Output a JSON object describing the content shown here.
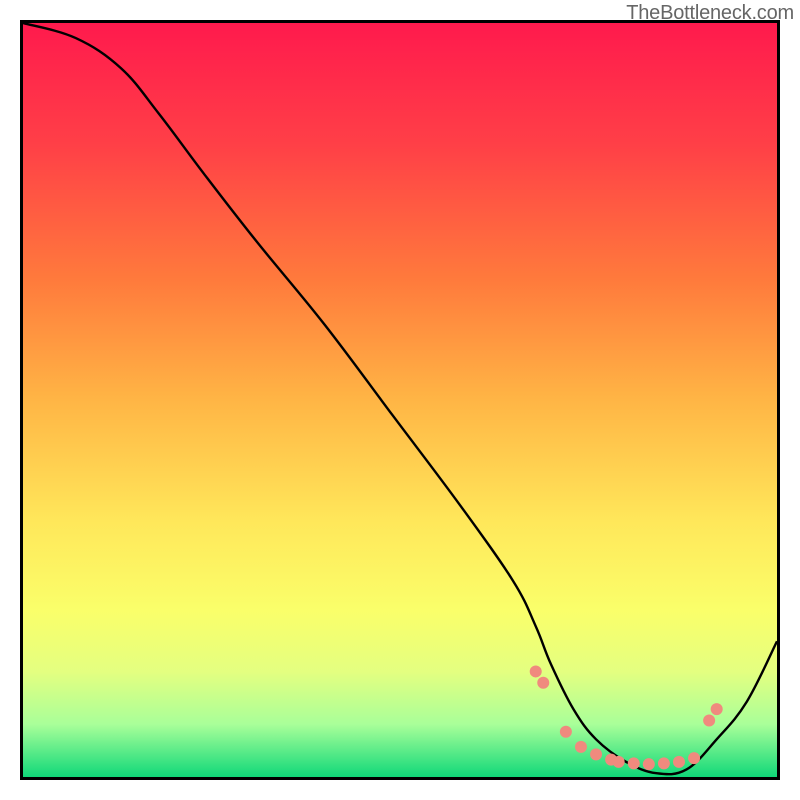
{
  "watermark": "TheBottleneck.com",
  "chart_data": {
    "type": "line",
    "title": "",
    "xlabel": "",
    "ylabel": "",
    "xlim": [
      0,
      100
    ],
    "ylim": [
      0,
      100
    ],
    "background_gradient": {
      "type": "vertical",
      "stops": [
        {
          "pos": 0.0,
          "color": "#ff1a4d"
        },
        {
          "pos": 0.16,
          "color": "#ff3f47"
        },
        {
          "pos": 0.34,
          "color": "#ff7a3c"
        },
        {
          "pos": 0.5,
          "color": "#ffb545"
        },
        {
          "pos": 0.66,
          "color": "#ffe75a"
        },
        {
          "pos": 0.78,
          "color": "#faff6a"
        },
        {
          "pos": 0.86,
          "color": "#e4ff80"
        },
        {
          "pos": 0.93,
          "color": "#a9ff99"
        },
        {
          "pos": 1.0,
          "color": "#10d879"
        }
      ]
    },
    "series": [
      {
        "name": "bottleneck-curve",
        "color": "#000000",
        "stroke_width": 2.4,
        "x": [
          0,
          7,
          13,
          18,
          24,
          31,
          40,
          49,
          58,
          65,
          68,
          70,
          73,
          76,
          80,
          84,
          88,
          92,
          96,
          100
        ],
        "y": [
          100,
          98,
          94,
          88,
          80,
          71,
          60,
          48,
          36,
          26,
          20,
          15,
          9,
          5,
          2,
          0.5,
          1,
          5,
          10,
          18
        ]
      }
    ],
    "markers": {
      "name": "dot-region",
      "shape": "circle",
      "color": "#f08a7e",
      "radius_px": 6,
      "points": [
        {
          "x": 68,
          "y": 14
        },
        {
          "x": 69,
          "y": 12.5
        },
        {
          "x": 72,
          "y": 6
        },
        {
          "x": 74,
          "y": 4
        },
        {
          "x": 76,
          "y": 3
        },
        {
          "x": 78,
          "y": 2.3
        },
        {
          "x": 79,
          "y": 2
        },
        {
          "x": 81,
          "y": 1.8
        },
        {
          "x": 83,
          "y": 1.7
        },
        {
          "x": 85,
          "y": 1.8
        },
        {
          "x": 87,
          "y": 2
        },
        {
          "x": 89,
          "y": 2.5
        },
        {
          "x": 91,
          "y": 7.5
        },
        {
          "x": 92,
          "y": 9
        }
      ]
    }
  }
}
